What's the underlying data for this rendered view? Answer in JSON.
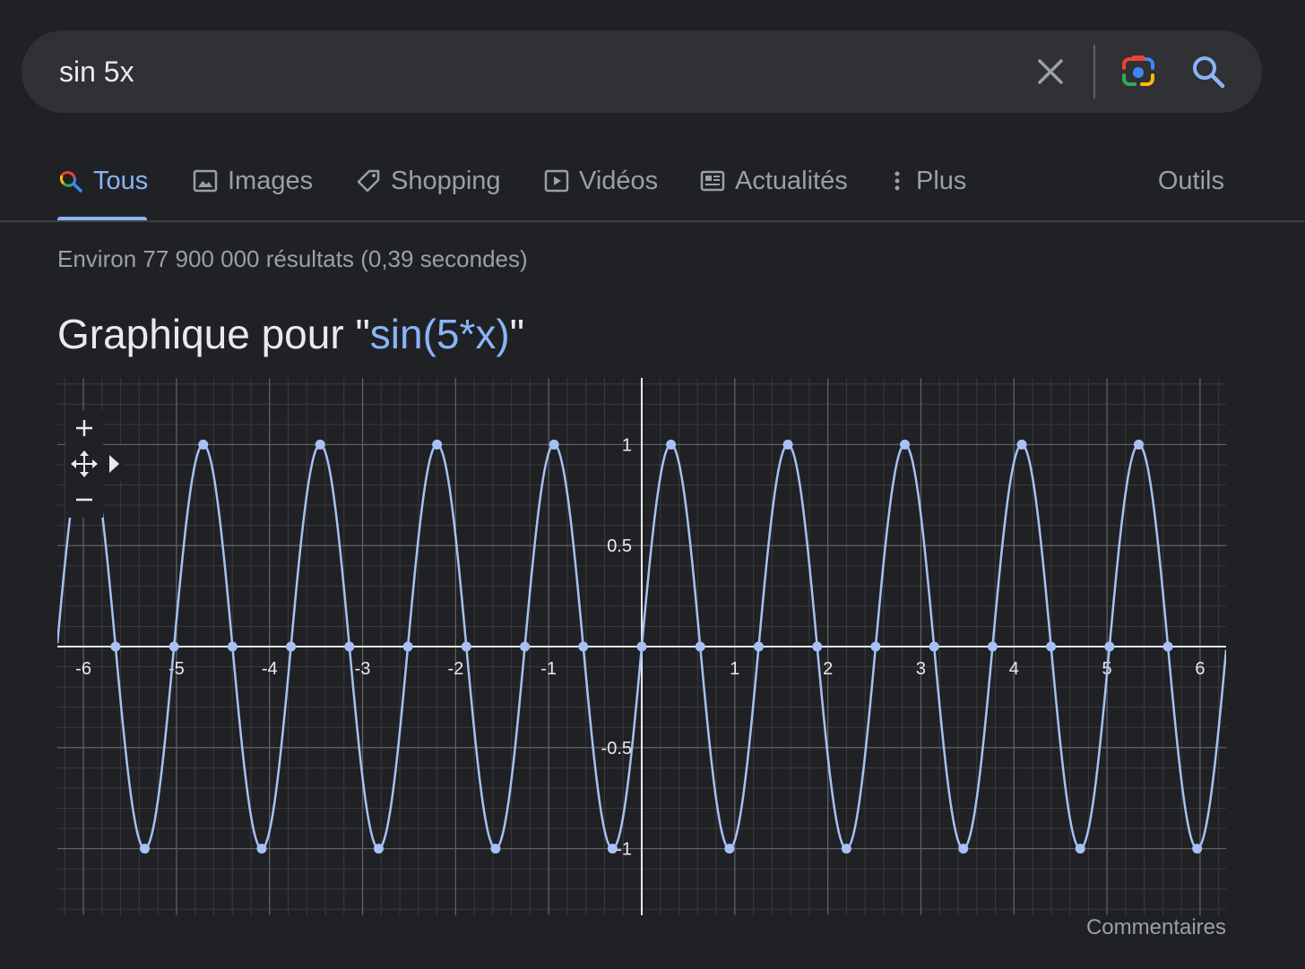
{
  "search": {
    "query": "sin 5x",
    "clear_icon": "close-icon",
    "lens_icon": "camera-lens-icon",
    "search_icon": "search-icon"
  },
  "tabs": [
    {
      "label": "Tous",
      "icon": "multicolor-search-icon",
      "active": true
    },
    {
      "label": "Images",
      "icon": "image-icon"
    },
    {
      "label": "Shopping",
      "icon": "tag-icon"
    },
    {
      "label": "Vidéos",
      "icon": "play-icon"
    },
    {
      "label": "Actualités",
      "icon": "newspaper-icon"
    },
    {
      "label": "Plus",
      "icon": "more-vertical-icon"
    }
  ],
  "tools_label": "Outils",
  "result_stats": "Environ 77 900 000 résultats (0,39 secondes)",
  "graph_title": {
    "prefix": "Graphique pour \"",
    "expression": "sin(5*x)",
    "suffix": "\""
  },
  "feedback_label": "Commentaires",
  "colors": {
    "background": "#202124",
    "accent": "#8ab4f8",
    "curve": "#a7c0f5"
  },
  "chart_data": {
    "type": "line",
    "function": "sin(5*x)",
    "xlim": [
      -6.28,
      6.28
    ],
    "ylim": [
      -1.33,
      1.33
    ],
    "x_ticks": [
      -6,
      -5,
      -4,
      -3,
      -2,
      -1,
      1,
      2,
      3,
      4,
      5,
      6
    ],
    "x_tick_labels": [
      "-6",
      "-5",
      "-4",
      "-3",
      "-2",
      "-1",
      "1",
      "2",
      "3",
      "4",
      "5",
      "6"
    ],
    "y_ticks": [
      1,
      0.5,
      -0.5,
      -1
    ],
    "y_tick_labels": [
      "1",
      "0.5",
      "-0.5",
      "-1"
    ],
    "grid": true,
    "marked_points": "maxima, minima and zeros"
  }
}
